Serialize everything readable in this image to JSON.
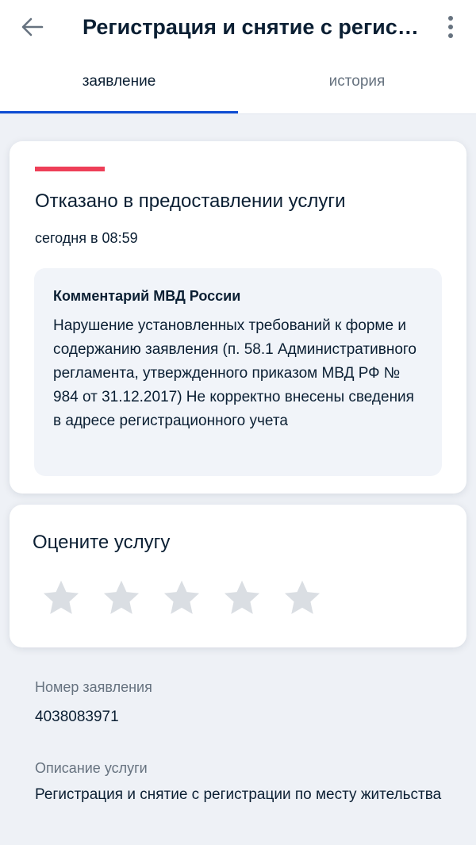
{
  "header": {
    "title": "Регистрация и снятие с регистрации по месту жительства",
    "back_icon": "arrow-left-icon",
    "menu_icon": "more-vertical-icon"
  },
  "tabs": [
    {
      "label": "заявление",
      "active": true
    },
    {
      "label": "история",
      "active": false
    }
  ],
  "status": {
    "title": "Отказано в предоставлении услуги",
    "time": "сегодня в 08:59",
    "color": "#ee3f58",
    "comment": {
      "title": "Комментарий МВД России",
      "text": "Нарушение установленных требований к форме и содержанию заявления (п. 58.1 Административного регламента, утвержденного приказом МВД РФ № 984 от 31.12.2017) Не корректно внесены сведения в адресе регистрационного учета"
    }
  },
  "rating": {
    "title": "Оцените услугу",
    "max_stars": 5,
    "selected": 0,
    "star_icon": "star-icon"
  },
  "application": {
    "number_label": "Номер заявления",
    "number": "4038083971",
    "description_label": "Описание услуги",
    "description": "Регистрация и снятие с регистрации по месту жительства"
  },
  "colors": {
    "accent": "#0d4cd3",
    "error": "#ee3f58",
    "text": "#0b1f33",
    "muted": "#66727f",
    "star": "#dadee3"
  }
}
